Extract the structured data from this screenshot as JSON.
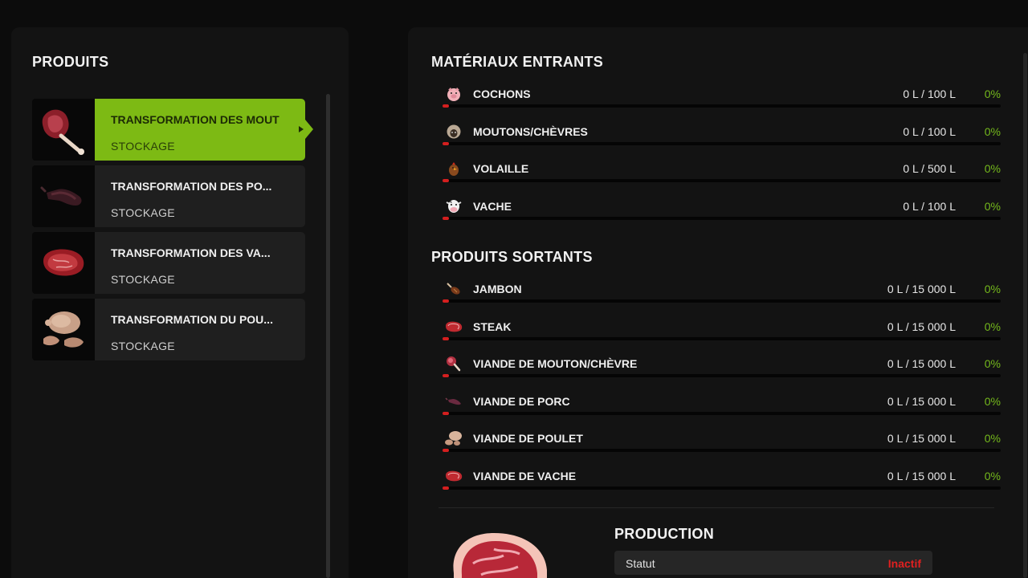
{
  "products": {
    "heading": "PRODUITS",
    "items": [
      {
        "title": "TRANSFORMATION DES MOUT",
        "subtitle": "STOCKAGE",
        "icon": "mutton-leg-icon",
        "active": true
      },
      {
        "title": "TRANSFORMATION DES PO...",
        "subtitle": "STOCKAGE",
        "icon": "pork-icon",
        "active": false
      },
      {
        "title": "TRANSFORMATION DES VA...",
        "subtitle": "STOCKAGE",
        "icon": "beef-steak-icon",
        "active": false
      },
      {
        "title": "TRANSFORMATION DU POU...",
        "subtitle": "STOCKAGE",
        "icon": "roast-chicken-icon",
        "active": false
      }
    ]
  },
  "inputs": {
    "heading": "MATÉRIAUX ENTRANTS",
    "rows": [
      {
        "icon": "pig-icon",
        "label": "COCHONS",
        "value": "0 L / 100 L",
        "percent": "0%",
        "fill": 0
      },
      {
        "icon": "sheep-icon",
        "label": "MOUTONS/CHÈVRES",
        "value": "0 L / 100 L",
        "percent": "0%",
        "fill": 0
      },
      {
        "icon": "chicken-icon",
        "label": "VOLAILLE",
        "value": "0 L / 500 L",
        "percent": "0%",
        "fill": 0
      },
      {
        "icon": "cow-icon",
        "label": "VACHE",
        "value": "0 L / 100 L",
        "percent": "0%",
        "fill": 0
      }
    ]
  },
  "outputs": {
    "heading": "PRODUITS SORTANTS",
    "rows": [
      {
        "icon": "ham-icon",
        "label": "JAMBON",
        "value": "0 L / 15 000 L",
        "percent": "0%",
        "fill": 0
      },
      {
        "icon": "steak-icon",
        "label": "STEAK",
        "value": "0 L / 15 000 L",
        "percent": "0%",
        "fill": 0
      },
      {
        "icon": "mutton-leg-icon",
        "label": "VIANDE DE MOUTON/CHÈVRE",
        "value": "0 L / 15 000 L",
        "percent": "0%",
        "fill": 0
      },
      {
        "icon": "pork-icon",
        "label": "VIANDE DE PORC",
        "value": "0 L / 15 000 L",
        "percent": "0%",
        "fill": 0
      },
      {
        "icon": "chicken-meat-icon",
        "label": "VIANDE DE POULET",
        "value": "0 L / 15 000 L",
        "percent": "0%",
        "fill": 0
      },
      {
        "icon": "beef-steak-icon",
        "label": "VIANDE DE VACHE",
        "value": "0 L / 15 000 L",
        "percent": "0%",
        "fill": 0
      }
    ]
  },
  "production": {
    "heading": "PRODUCTION",
    "status_label": "Statut",
    "status_value": "Inactif"
  },
  "colors": {
    "accent": "#7dba14",
    "percent": "#74b81c",
    "bar_fill": "#d41f1f",
    "status_inactive": "#e02020"
  }
}
